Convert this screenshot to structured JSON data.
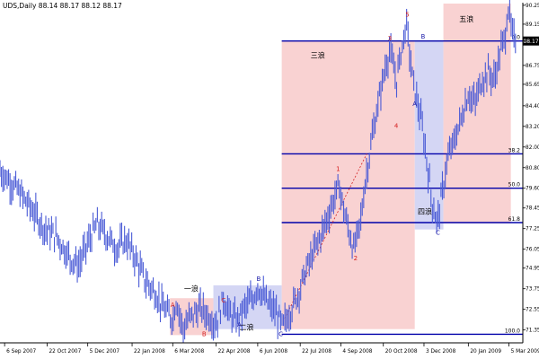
{
  "header": {
    "symbol": "UDS",
    "period": "Daily",
    "ohlc": "88.14 88.17 88.12 88.17"
  },
  "colors": {
    "background": "#ffffff",
    "candle": "#4a5bd6",
    "up_zone": "#f9d2d2",
    "down_zone": "#d4d6f4",
    "fib_line": "#0000aa",
    "wave_red": "#d42020",
    "wave_blue": "#1a1aa8",
    "price_tag": "#000000"
  },
  "chart_data": {
    "type": "line",
    "style": "ohlc-bars",
    "grid": false,
    "y_ticks": [
      "90.25",
      "89.15",
      "88.17",
      "86.75",
      "85.65",
      "84.40",
      "83.20",
      "82.00",
      "80.80",
      "79.60",
      "78.45",
      "77.25",
      "76.05",
      "74.95",
      "73.75",
      "72.55",
      "71.35"
    ],
    "ylim": [
      70.6,
      90.4
    ],
    "current_price_label": "88.17",
    "x_ticks": [
      "6 Sep 2007",
      "22 Oct 2007",
      "5 Dec 2007",
      "22 Jan 2008",
      "6 Mar 2008",
      "22 Apr 2008",
      "6 Jun 2008",
      "22 Jul 2008",
      "4 Sep 2008",
      "20 Oct 2008",
      "3 Dec 2008",
      "20 Jan 2009",
      "5 Mar 2009"
    ],
    "x_range": [
      "2007-09-01",
      "2009-03-20"
    ],
    "price_path": [
      [
        "2007-09-01",
        80.6
      ],
      [
        "2007-09-20",
        79.5
      ],
      [
        "2007-10-05",
        78.4
      ],
      [
        "2007-10-20",
        77.2
      ],
      [
        "2007-11-01",
        76.8
      ],
      [
        "2007-11-15",
        75.6
      ],
      [
        "2007-11-25",
        75.1
      ],
      [
        "2007-12-05",
        76.4
      ],
      [
        "2007-12-15",
        77.5
      ],
      [
        "2007-12-25",
        76.9
      ],
      [
        "2008-01-05",
        76.1
      ],
      [
        "2008-01-15",
        76.6
      ],
      [
        "2008-01-25",
        75.6
      ],
      [
        "2008-02-05",
        74.2
      ],
      [
        "2008-02-15",
        73.6
      ],
      [
        "2008-02-25",
        72.6
      ],
      [
        "2008-03-06",
        72.0
      ],
      [
        "2008-03-10",
        73.1
      ],
      [
        "2008-03-17",
        71.4
      ],
      [
        "2008-03-25",
        72.1
      ],
      [
        "2008-04-05",
        72.6
      ],
      [
        "2008-04-15",
        72.1
      ],
      [
        "2008-04-22",
        71.7
      ],
      [
        "2008-04-30",
        73.2
      ],
      [
        "2008-05-07",
        72.2
      ],
      [
        "2008-05-15",
        71.9
      ],
      [
        "2008-05-22",
        72.6
      ],
      [
        "2008-06-01",
        73.2
      ],
      [
        "2008-06-06",
        73.9
      ],
      [
        "2008-06-15",
        73.0
      ],
      [
        "2008-06-25",
        72.4
      ],
      [
        "2008-07-03",
        71.55
      ],
      [
        "2008-07-10",
        72.3
      ],
      [
        "2008-07-20",
        73.5
      ],
      [
        "2008-07-28",
        74.8
      ],
      [
        "2008-08-05",
        75.8
      ],
      [
        "2008-08-15",
        77.1
      ],
      [
        "2008-08-25",
        78.6
      ],
      [
        "2008-09-02",
        79.8
      ],
      [
        "2008-09-08",
        78.1
      ],
      [
        "2008-09-18",
        76.0
      ],
      [
        "2008-09-25",
        77.6
      ],
      [
        "2008-10-01",
        80.2
      ],
      [
        "2008-10-08",
        82.6
      ],
      [
        "2008-10-15",
        84.7
      ],
      [
        "2008-10-22",
        86.6
      ],
      [
        "2008-10-27",
        87.7
      ],
      [
        "2008-11-03",
        85.8
      ],
      [
        "2008-11-08",
        87.5
      ],
      [
        "2008-11-14",
        89.2
      ],
      [
        "2008-11-20",
        86.2
      ],
      [
        "2008-11-25",
        84.8
      ],
      [
        "2008-12-01",
        83.2
      ],
      [
        "2008-12-06",
        81.2
      ],
      [
        "2008-12-11",
        79.0
      ],
      [
        "2008-12-17",
        77.6
      ],
      [
        "2008-12-23",
        79.4
      ],
      [
        "2008-12-28",
        81.2
      ],
      [
        "2009-01-05",
        82.4
      ],
      [
        "2009-01-12",
        83.6
      ],
      [
        "2009-01-20",
        85.1
      ],
      [
        "2009-01-27",
        84.5
      ],
      [
        "2009-02-03",
        85.8
      ],
      [
        "2009-02-10",
        86.4
      ],
      [
        "2009-02-17",
        85.9
      ],
      [
        "2009-02-23",
        87.4
      ],
      [
        "2009-03-01",
        88.5
      ],
      [
        "2009-03-04",
        90.2
      ],
      [
        "2009-03-08",
        88.6
      ],
      [
        "2009-03-12",
        88.17
      ]
    ],
    "fibonacci_levels": [
      {
        "label": "0.0",
        "price": 88.17
      },
      {
        "label": "38.2",
        "price": 81.6
      },
      {
        "label": "50.0",
        "price": 79.6
      },
      {
        "label": "61.8",
        "price": 77.6
      },
      {
        "label": "100.0",
        "price": 71.1
      }
    ],
    "wave_zones": [
      {
        "kind": "up",
        "label": "一浪",
        "x0": "2008-03-03",
        "x1": "2008-04-19",
        "y0": 71.05,
        "y1": 73.2
      },
      {
        "kind": "down",
        "label": "二浪",
        "x0": "2008-04-19",
        "x1": "2008-07-02",
        "y0": 71.4,
        "y1": 73.95
      },
      {
        "kind": "up",
        "label": "三浪",
        "x0": "2008-07-02",
        "x1": "2008-11-23",
        "y0": 71.4,
        "y1": 88.17
      },
      {
        "kind": "down",
        "label": "四浪",
        "x0": "2008-11-23",
        "x1": "2008-12-24",
        "y0": 77.2,
        "y1": 88.17
      },
      {
        "kind": "up",
        "label": "五浪",
        "x0": "2008-12-24",
        "x1": "2009-03-07",
        "y0": 77.55,
        "y1": 90.35
      }
    ],
    "wave_labels": [
      {
        "text": "A",
        "color": "red",
        "date": "2008-03-06",
        "price": 72.7
      },
      {
        "text": "B",
        "color": "red",
        "date": "2008-04-09",
        "price": 71.0
      },
      {
        "text": "C",
        "color": "red",
        "date": "2008-04-30",
        "price": 72.95
      },
      {
        "text": "A",
        "color": "blue",
        "date": "2008-05-17",
        "price": 71.55
      },
      {
        "text": "B",
        "color": "blue",
        "date": "2008-06-07",
        "price": 74.2
      },
      {
        "text": "C",
        "color": "blue",
        "date": "2008-07-01",
        "price": 71.0
      },
      {
        "text": "1",
        "color": "red",
        "date": "2008-09-01",
        "price": 80.6
      },
      {
        "text": "2",
        "color": "red",
        "date": "2008-09-20",
        "price": 75.4
      },
      {
        "text": "3",
        "color": "red",
        "date": "2008-10-27",
        "price": 88.2
      },
      {
        "text": "4",
        "color": "red",
        "date": "2008-11-03",
        "price": 83.1
      },
      {
        "text": "5",
        "color": "red",
        "date": "2008-11-15",
        "price": 89.6
      },
      {
        "text": "A",
        "color": "blue",
        "date": "2008-11-23",
        "price": 84.4
      },
      {
        "text": "B",
        "color": "blue",
        "date": "2008-12-02",
        "price": 88.3
      },
      {
        "text": "C",
        "color": "blue",
        "date": "2008-12-18",
        "price": 76.9
      }
    ],
    "dashed_trend": [
      [
        "2008-07-05",
        72.0
      ],
      [
        "2008-10-02",
        81.6
      ]
    ]
  }
}
